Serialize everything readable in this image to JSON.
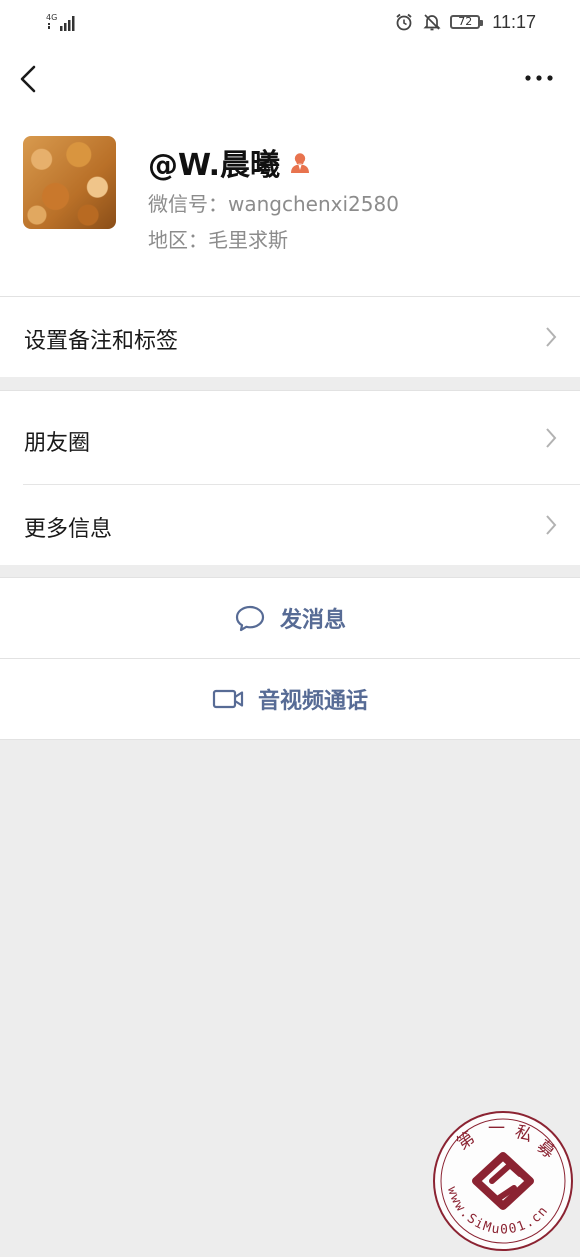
{
  "status_bar": {
    "network": "4G",
    "battery": "72",
    "time": "11:17"
  },
  "profile": {
    "name": "@W.晨曦",
    "wechat_id": "微信号：wangchenxi2580",
    "region": "地区：毛里求斯"
  },
  "menu": {
    "remarks_tags": "设置备注和标签",
    "moments": "朋友圈",
    "more_info": "更多信息"
  },
  "actions": {
    "send_message": "发消息",
    "av_call": "音视频通话"
  },
  "watermark": {
    "chars": [
      "第",
      "一",
      "私",
      "募"
    ],
    "url": "www.SiMu001.cn"
  },
  "colors": {
    "link": "#576b95",
    "background": "#ededed",
    "gender_female": "#e8734e",
    "watermark": "#8b2332"
  }
}
